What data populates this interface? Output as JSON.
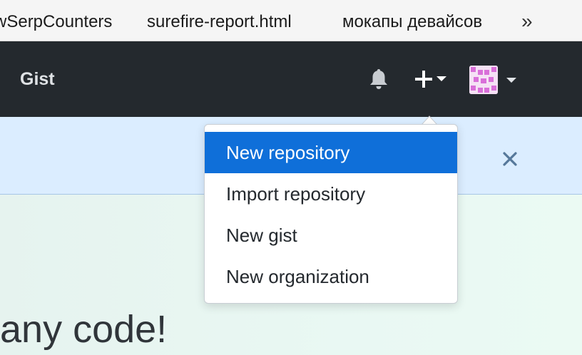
{
  "bookmarks": [
    {
      "label": "wSerpCounters"
    },
    {
      "label": "surefire-report.html"
    },
    {
      "label": "мокапы девайсов"
    }
  ],
  "bookmarks_more": "»",
  "header": {
    "gist_label": "Gist",
    "icons": [
      "bell-icon",
      "plus-icon",
      "avatar"
    ]
  },
  "dropdown": {
    "items": [
      {
        "label": "New repository",
        "active": true
      },
      {
        "label": "Import repository",
        "active": false
      },
      {
        "label": "New gist",
        "active": false
      },
      {
        "label": "New organization",
        "active": false
      }
    ]
  },
  "hero": {
    "text": "any code!"
  },
  "colors": {
    "header_bg": "#24292e",
    "flash_bg": "#dbedff",
    "menu_active": "#0f6fd9",
    "close_icon": "#56789a"
  }
}
